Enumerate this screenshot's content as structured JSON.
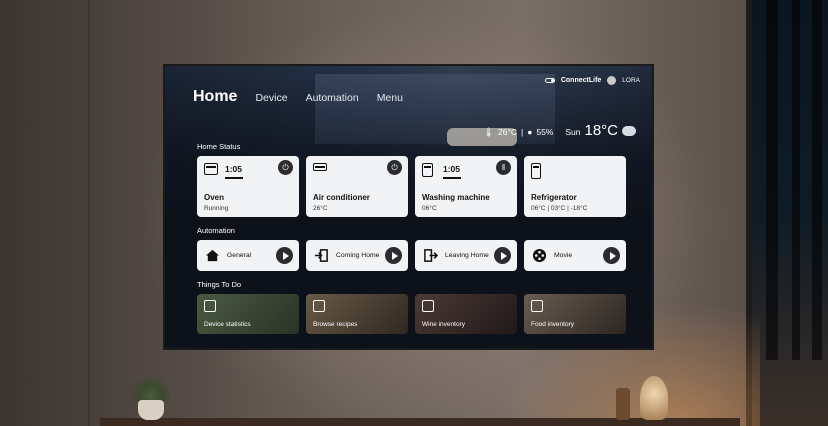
{
  "app": {
    "title": "Home",
    "nav": [
      "Device",
      "Automation",
      "Menu"
    ],
    "brand": "ConnectLife",
    "user": "LORA"
  },
  "weather": {
    "indoor_temp": "26°C",
    "separator": "|",
    "humidity": "55%",
    "day": "Sun",
    "outdoor_temp": "18°C"
  },
  "sections": {
    "home_status": "Home Status",
    "automation": "Automation",
    "things_to_do": "Things To Do"
  },
  "home_status": [
    {
      "name": "Oven",
      "time": "1:05",
      "sub": "Running",
      "button": "power",
      "icon": "oven-icon"
    },
    {
      "name": "Air conditioner",
      "time": "",
      "sub": "26°C",
      "button": "power",
      "icon": "air-conditioner-icon"
    },
    {
      "name": "Washing machine",
      "time": "1:05",
      "sub": "06°C",
      "button": "pause",
      "icon": "washing-machine-icon"
    },
    {
      "name": "Refrigerator",
      "time": "",
      "sub": "06°C | 03°C | -18°C",
      "button": "",
      "icon": "refrigerator-icon"
    }
  ],
  "automation": [
    {
      "label": "General",
      "icon": "home-icon"
    },
    {
      "label": "Coming Home",
      "icon": "door-enter-icon"
    },
    {
      "label": "Leaving Home",
      "icon": "door-exit-icon"
    },
    {
      "label": "Movie",
      "icon": "film-reel-icon"
    }
  ],
  "things_to_do": [
    {
      "label": "Device statistics",
      "icon": "plug-icon",
      "bg": "#3e4a38"
    },
    {
      "label": "Browse recipes",
      "icon": "bowl-icon",
      "bg": "#4a4036"
    },
    {
      "label": "Wine inventory",
      "icon": "bottle-icon",
      "bg": "#3a3030"
    },
    {
      "label": "Food inventory",
      "icon": "food-icon",
      "bg": "#50443c"
    }
  ],
  "colors": {
    "card_bg": "#f2f3f5",
    "button_dark": "#2a2c30",
    "tv_bg": "#0d111a",
    "text_light": "#ffffff"
  }
}
